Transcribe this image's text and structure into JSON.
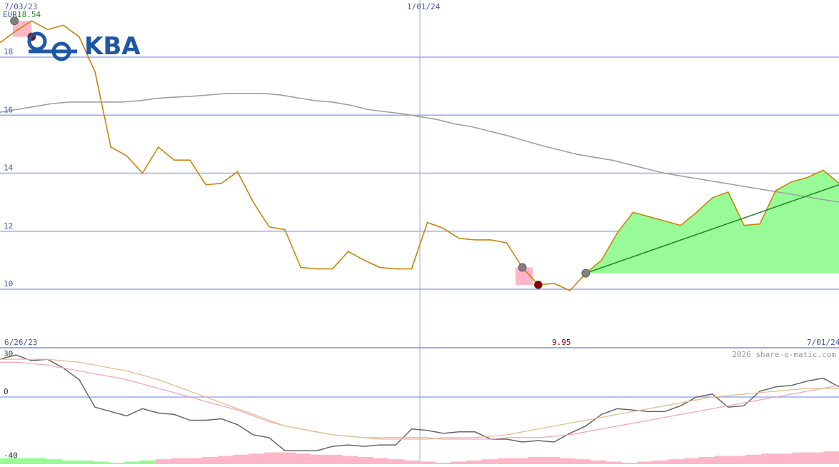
{
  "logo": {
    "text": "KBA"
  },
  "price_box": {
    "currency": "EUR",
    "value": "18.54"
  },
  "date_labels": {
    "top_left": "7/03/23",
    "top_mid": "1/01/24",
    "bottom_left": "6/26/23",
    "bottom_right": "7/01/24"
  },
  "low_label": "9.95",
  "watermark": "2026 share-o-matic.com",
  "colors": {
    "price": "#c8860a",
    "ma": "#a0a0a0",
    "trend": "#228b22",
    "trend_fill": "#98fb98",
    "buy_marker": "#8b0000",
    "signal_marker": "#808080",
    "grid": "#99aaee",
    "axis_text": "#4455aa",
    "osc_line": "#666666",
    "osc_signal1": "#f4a6bc",
    "osc_signal2": "#e0c090",
    "hist_pos": "#98fb98",
    "hist_neg": "#ffb6c8",
    "logo": "#1f57a5"
  },
  "chart_data": [
    {
      "type": "line",
      "title": "",
      "y_ticks": [
        "10",
        "12",
        "14",
        "16",
        "18"
      ],
      "ylim": [
        9.4,
        19.3
      ],
      "x_range": [
        "2023-06-26",
        "2024-07-01"
      ],
      "grid": true,
      "series": [
        {
          "values": [
            18.5,
            18.9,
            19.25,
            18.95,
            19.1,
            18.7,
            17.5,
            14.9,
            14.6,
            14.0,
            14.9,
            14.45,
            14.45,
            13.6,
            13.65,
            14.05,
            13.0,
            12.15,
            12.05,
            10.75,
            10.7,
            10.7,
            11.3,
            11.0,
            10.75,
            10.7,
            10.7,
            12.3,
            12.1,
            11.75,
            11.7,
            11.7,
            11.6,
            10.75,
            10.15,
            10.2,
            9.95,
            10.55,
            11.0,
            11.95,
            12.65,
            12.5,
            12.35,
            12.2,
            12.65,
            13.15,
            13.35,
            12.2,
            12.25,
            13.4,
            13.7,
            13.85,
            14.1,
            13.65
          ]
        },
        {
          "values": [
            16.1,
            16.2,
            16.3,
            16.4,
            16.45,
            16.45,
            16.45,
            16.45,
            16.5,
            16.58,
            16.62,
            16.65,
            16.7,
            16.75,
            16.75,
            16.75,
            16.7,
            16.6,
            16.5,
            16.45,
            16.35,
            16.2,
            16.12,
            16.05,
            15.95,
            15.85,
            15.7,
            15.6,
            15.45,
            15.3,
            15.12,
            14.95,
            14.8,
            14.65,
            14.55,
            14.45,
            14.3,
            14.15,
            14.0,
            13.9,
            13.8,
            13.7,
            13.6,
            13.5,
            13.4,
            13.3,
            13.2,
            13.1,
            13.0
          ]
        }
      ],
      "signals": [
        {
          "type": "sell",
          "x_index": 1,
          "y": 19.25
        },
        {
          "type": "buy",
          "x_index": 2,
          "y": 18.7
        },
        {
          "type": "sell",
          "x_index": 33,
          "y": 10.75
        },
        {
          "type": "buy",
          "x_index": 34,
          "y": 10.15
        },
        {
          "type": "signal",
          "x_index": 37,
          "y": 10.55
        }
      ],
      "trend_line": {
        "from": [
          37,
          10.55
        ],
        "to": [
          53,
          13.6
        ]
      }
    },
    {
      "type": "line",
      "title": "",
      "y_ticks": [
        "30",
        "0",
        "-40"
      ],
      "ylim": [
        -40,
        30
      ],
      "grid": true,
      "series": [
        {
          "values": [
            26,
            29,
            25,
            26,
            20,
            12,
            -7,
            -10,
            -13,
            -8,
            -11,
            -12,
            -16,
            -16,
            -15,
            -19,
            -26,
            -28,
            -37,
            -37,
            -37,
            -34,
            -33,
            -34,
            -33,
            -33,
            -22,
            -23,
            -25,
            -24,
            -24,
            -29,
            -29,
            -31,
            -30,
            -31,
            -25,
            -20,
            -12,
            -8,
            -9,
            -10,
            -10,
            -6,
            0,
            2,
            -7,
            -6,
            4,
            7,
            8,
            11,
            13,
            7
          ]
        },
        {
          "values": [
            24,
            24,
            23,
            22,
            20,
            18,
            16,
            14,
            12,
            9,
            6,
            3,
            0,
            -3,
            -6,
            -9,
            -13,
            -17,
            -20,
            -22,
            -24,
            -26,
            -27,
            -28,
            -28,
            -28,
            -28,
            -28,
            -29,
            -29,
            -29,
            -29,
            -28,
            -28,
            -28,
            -27,
            -26,
            -24,
            -22,
            -20,
            -18,
            -16,
            -14,
            -12,
            -10,
            -8,
            -6,
            -4,
            -2,
            0,
            2,
            4,
            6,
            8
          ]
        },
        {
          "values": [
            26,
            26,
            26,
            26,
            25,
            24,
            22,
            20,
            18,
            15,
            12,
            8,
            4,
            0,
            -4,
            -8,
            -12,
            -16,
            -20,
            -22,
            -24,
            -26,
            -27,
            -28,
            -29,
            -29,
            -29,
            -29,
            -28,
            -28,
            -28,
            -27,
            -26,
            -24,
            -22,
            -20,
            -18,
            -16,
            -14,
            -12,
            -10,
            -8,
            -6,
            -4,
            -2,
            0,
            1,
            2,
            3,
            4,
            5,
            6,
            6,
            6
          ]
        }
      ],
      "histogram": [
        4,
        4,
        4,
        3,
        2,
        2,
        1,
        0,
        -1,
        -2,
        -3,
        -4,
        -4,
        -5,
        -6,
        -7,
        -8,
        -9,
        -9,
        -8,
        -7,
        -7,
        -6,
        -5,
        -4,
        -3,
        -2,
        -1,
        0,
        1,
        2,
        3,
        4,
        4,
        5,
        5,
        4,
        3,
        2,
        1,
        0,
        1,
        2,
        3,
        4,
        5,
        6,
        6,
        7,
        8,
        8,
        9,
        9,
        10
      ]
    }
  ]
}
